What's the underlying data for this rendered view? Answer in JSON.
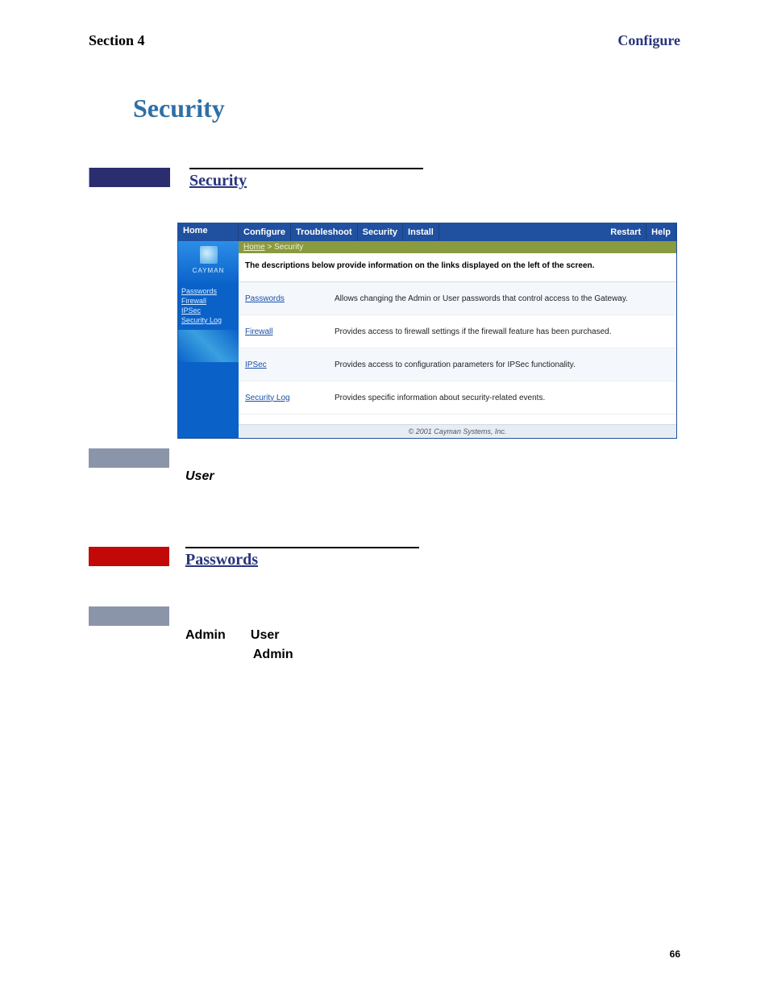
{
  "header": {
    "section": "Section 4",
    "title": "Configure"
  },
  "main_heading": "Security",
  "subhead_security": "Security",
  "subhead_passwords": "Passwords",
  "app": {
    "home": "Home",
    "tabs": [
      "Configure",
      "Troubleshoot",
      "Security",
      "Install"
    ],
    "right_tabs": [
      "Restart",
      "Help"
    ],
    "logo_text": "CAYMAN",
    "side_links": [
      "Passwords",
      "Firewall",
      "IPSec",
      "Security Log"
    ],
    "breadcrumb_home": "Home",
    "breadcrumb_sep": " > ",
    "breadcrumb_page": "Security",
    "description": "The descriptions below provide information on the links displayed on the left of the screen.",
    "rows": [
      {
        "link": "Passwords",
        "text": "Allows changing the Admin or User passwords that control access to the Gateway."
      },
      {
        "link": "Firewall",
        "text": "Provides access to firewall settings if the firewall feature has been purchased."
      },
      {
        "link": "IPSec",
        "text": "Provides access to configuration parameters for IPSec functionality."
      },
      {
        "link": "Security Log",
        "text": "Provides specific information about security-related events."
      }
    ],
    "footer": "© 2001 Cayman Systems, Inc."
  },
  "user_label": "User",
  "passwords_body": {
    "admin1": "Admin",
    "user": "User",
    "admin2": "Admin"
  },
  "page_number": "66"
}
